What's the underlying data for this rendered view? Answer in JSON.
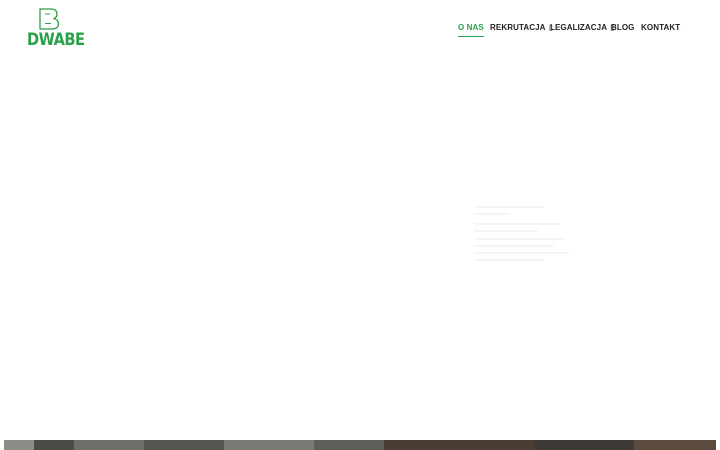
{
  "brand": {
    "name": "DWABE",
    "color": "#2aa048",
    "icon": "letter-b-logo-icon"
  },
  "nav": {
    "items": [
      {
        "label": "O NAS",
        "active": true,
        "has_dropdown": false
      },
      {
        "label": "REKRUTACJA",
        "active": false,
        "has_dropdown": true
      },
      {
        "label": "LEGALIZACJA",
        "active": false,
        "has_dropdown": true
      },
      {
        "label": "BLOG",
        "active": false,
        "has_dropdown": false
      },
      {
        "label": "KONTAKT",
        "active": false,
        "has_dropdown": false
      }
    ],
    "dropdown_glyph": "▯",
    "active_color": "#2aa048"
  }
}
